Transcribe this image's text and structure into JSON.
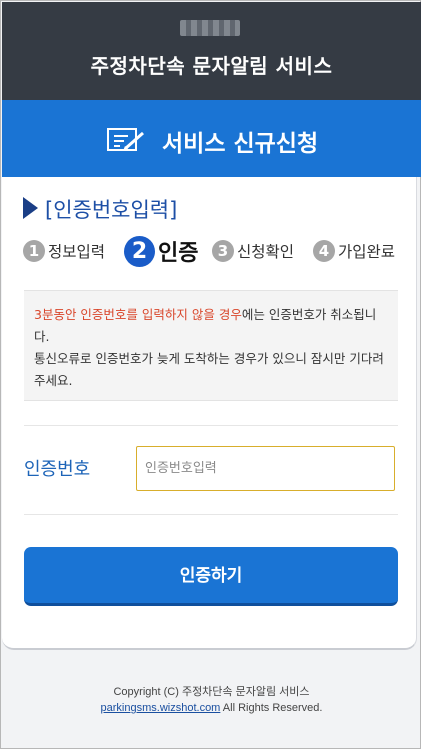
{
  "header": {
    "app_title": "주정차단속 문자알림 서비스"
  },
  "banner": {
    "icon": "form-edit-icon",
    "title": "서비스 신규신청"
  },
  "section": {
    "title": "[인증번호입력]"
  },
  "steps": [
    {
      "num": "1",
      "label": "정보입력",
      "active": false
    },
    {
      "num": "2",
      "label": "인증",
      "active": true
    },
    {
      "num": "3",
      "label": "신청확인",
      "active": false
    },
    {
      "num": "4",
      "label": "가입완료",
      "active": false
    }
  ],
  "notice": {
    "highlight": "3분동안 인증번호를 입력하지 않을 경우",
    "text1": "에는 인증번호가 취소됩니다.",
    "text2": "통신오류로 인증번호가 늦게 도착하는 경우가 있으니 잠시만 기다려주세요."
  },
  "form": {
    "code_label": "인증번호",
    "code_value": "",
    "code_placeholder": "인증번호입력",
    "submit_label": "인증하기"
  },
  "footer": {
    "copyright": "Copyright (C) 주정차단속 문자알림 서비스",
    "link_text": "parkingsms.wizshot.com",
    "rights": " All Rights Reserved."
  },
  "colors": {
    "header_bg": "#353b44",
    "accent_blue": "#1a74d4",
    "notice_red": "#d9472c",
    "input_border": "#d8ae2c"
  }
}
